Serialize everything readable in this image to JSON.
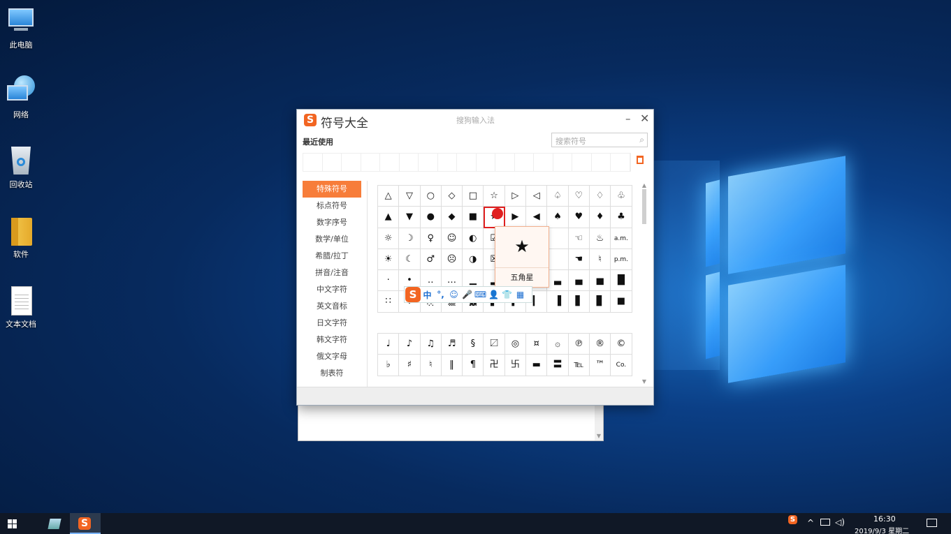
{
  "desktop": {
    "icons": [
      {
        "label": "此电脑",
        "icon": "computer-icon"
      },
      {
        "label": "网络",
        "icon": "network-icon"
      },
      {
        "label": "回收站",
        "icon": "recycle-bin-icon"
      },
      {
        "label": "软件",
        "icon": "folder-icon"
      },
      {
        "label": "文本文档",
        "icon": "text-document-icon"
      }
    ]
  },
  "symbol_window": {
    "title": "符号大全",
    "subtitle": "搜狗输入法",
    "minimize": "–",
    "close": "✕",
    "recent_label": "最近使用",
    "search_placeholder": "搜索符号",
    "categories": [
      "特殊符号",
      "标点符号",
      "数字序号",
      "数学/单位",
      "希腊/拉丁",
      "拼音/注音",
      "中文字符",
      "英文音标",
      "日文字符",
      "韩文字符",
      "俄文字母",
      "制表符"
    ],
    "active_category": "特殊符号",
    "grid1": [
      [
        "△",
        "▽",
        "○",
        "◇",
        "□",
        "☆",
        "▷",
        "◁",
        "♤",
        "♡",
        "♢",
        "♧"
      ],
      [
        "▲",
        "▼",
        "●",
        "◆",
        "■",
        "★",
        "▶",
        "◀",
        "♠",
        "♥",
        "♦",
        "♣"
      ],
      [
        "☼",
        "☽",
        "♀",
        "☺",
        "◐",
        "☑",
        "",
        "",
        "",
        "☜",
        "♨",
        "a.m."
      ],
      [
        "☀",
        "☾",
        "♂",
        "☹",
        "◑",
        "☒",
        "",
        "",
        "",
        "☚",
        "♮",
        "p.m."
      ],
      [
        "·",
        "•",
        "‥",
        "…",
        "▁",
        "▂",
        "",
        "",
        "▃",
        "▄",
        "▅",
        "█"
      ],
      [
        "∷",
        "※",
        "░",
        "▒",
        "▓",
        "▌",
        "▍",
        "▎",
        "▐",
        "▋",
        "▊",
        "■"
      ]
    ],
    "grid2": [
      [
        "♩",
        "♪",
        "♫",
        "♬",
        "§",
        "〼",
        "◎",
        "¤",
        "۞",
        "℗",
        "®",
        "©"
      ],
      [
        "♭",
        "♯",
        "♮",
        "‖",
        "¶",
        "卍",
        "卐",
        "▬",
        "〓",
        "℡",
        "™",
        "Co."
      ]
    ],
    "selected_symbol": "★",
    "tooltip": {
      "symbol": "★",
      "name": "五角星"
    }
  },
  "ime_toolbar": {
    "logo": "S",
    "items": [
      "中",
      "°,",
      "☺",
      "🎤",
      "⌨",
      "👤",
      "👕",
      "▦"
    ]
  },
  "taskbar": {
    "time": "16:30",
    "date": "2019/9/3 星期二",
    "tray_icons": [
      "ime-icon",
      "chevron-up-icon",
      "network-icon",
      "volume-icon",
      "notification-icon"
    ]
  }
}
